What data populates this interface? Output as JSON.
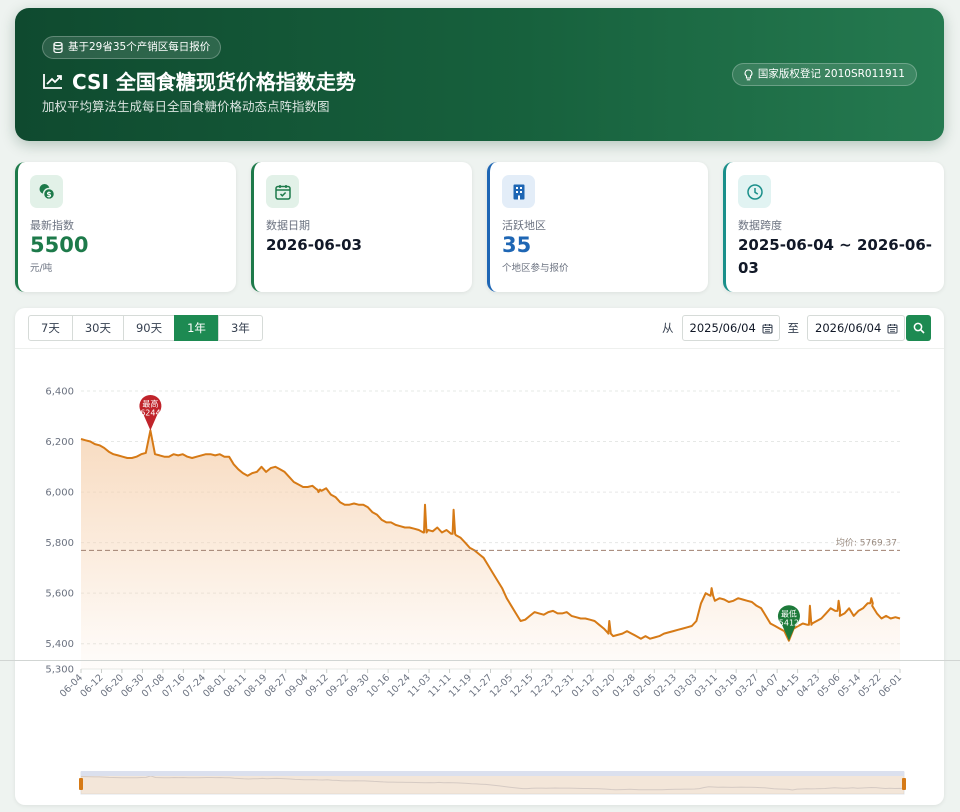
{
  "header": {
    "badge": "基于29省35个产销区每日报价",
    "title": "CSI 全国食糖现货价格指数走势",
    "subtitle": "加权平均算法生成每日全国食糖价格动态点阵指数图",
    "registration": "国家版权登记 2010SR011911"
  },
  "stats": [
    {
      "label": "最新指数",
      "value": "5500",
      "sub": "元/吨",
      "icon": "dollar-coins-icon",
      "color": "#1d7a4a"
    },
    {
      "label": "数据日期",
      "value": "2026-06-03",
      "sub": "",
      "icon": "calendar-check-icon",
      "color": "#1d7a4a"
    },
    {
      "label": "活跃地区",
      "value": "35",
      "sub": "个地区参与报价",
      "icon": "building-icon",
      "color": "#1e66b4"
    },
    {
      "label": "数据跨度",
      "value": "2025-06-04 ~ 2026-06-03",
      "sub": "",
      "icon": "clock-icon",
      "color": "#1a8f8a"
    }
  ],
  "controls": {
    "ranges": [
      "7天",
      "30天",
      "90天",
      "1年",
      "3年"
    ],
    "active_range": "1年",
    "from_label": "从",
    "from_date": "2025/06/04",
    "to_label": "至",
    "to_date": "2026/06/04"
  },
  "chart_data": {
    "type": "line",
    "title": "",
    "ylim": [
      5300,
      6400
    ],
    "yticks": [
      5300,
      5400,
      5600,
      5800,
      6000,
      6200,
      6400
    ],
    "ytick_labels": [
      "5,300",
      "5,400",
      "5,600",
      "5,800",
      "6,000",
      "6,200",
      "6,400"
    ],
    "xtick_labels": [
      "06-04",
      "06-12",
      "06-20",
      "06-30",
      "07-08",
      "07-16",
      "07-24",
      "08-01",
      "08-11",
      "08-19",
      "08-27",
      "09-04",
      "09-12",
      "09-22",
      "09-30",
      "10-16",
      "10-24",
      "11-03",
      "11-11",
      "11-19",
      "11-27",
      "12-05",
      "12-15",
      "12-23",
      "12-31",
      "01-12",
      "01-20",
      "01-28",
      "02-05",
      "02-13",
      "03-03",
      "03-11",
      "03-19",
      "03-27",
      "04-07",
      "04-15",
      "04-23",
      "05-06",
      "05-14",
      "05-22",
      "06-01"
    ],
    "series": [
      {
        "values": [
          6210,
          6205,
          6200,
          6190,
          6185,
          6175,
          6160,
          6150,
          6145,
          6140,
          6135,
          6135,
          6140,
          6150,
          6155,
          6244,
          6150,
          6145,
          6140,
          6140,
          6150,
          6145,
          6150,
          6140,
          6135,
          6140,
          6145,
          6150,
          6150,
          6145,
          6150,
          6140,
          6140,
          6110,
          6090,
          6075,
          6065,
          6075,
          6080,
          6100,
          6080,
          6095,
          6100,
          6090,
          6080,
          6060,
          6040,
          6030,
          6020,
          6020,
          6025,
          6010,
          6005,
          6015,
          5990,
          5980,
          5960,
          5950,
          5950,
          5955,
          5950,
          5950,
          5940,
          5920,
          5910,
          5890,
          5880,
          5880,
          5870,
          5865,
          5860,
          5860,
          5855,
          5850,
          5840,
          5850,
          5845,
          5860,
          5840,
          5850,
          5835,
          5830,
          5820,
          5800,
          5780,
          5770,
          5755,
          5740,
          5710,
          5680,
          5650,
          5620,
          5580,
          5550,
          5520,
          5490,
          5495,
          5510,
          5525,
          5520,
          5515,
          5525,
          5530,
          5520,
          5520,
          5525,
          5510,
          5505,
          5500,
          5500,
          5495,
          5490,
          5475,
          5460,
          5440,
          5430,
          5435,
          5440,
          5450,
          5440,
          5430,
          5420,
          5430,
          5420,
          5425,
          5430,
          5440,
          5445,
          5450,
          5455,
          5460,
          5465,
          5470,
          5490,
          5560,
          5600,
          5590,
          5570,
          5580,
          5575,
          5565,
          5570,
          5580,
          5575,
          5570,
          5565,
          5550,
          5540,
          5510,
          5480,
          5470,
          5460,
          5450,
          5412,
          5460,
          5470,
          5480,
          5475,
          5480,
          5490,
          5500,
          5520,
          5540,
          5530,
          5510,
          5520,
          5540,
          5510,
          5530,
          5540,
          5560,
          5550,
          5520,
          5500,
          5510,
          5500,
          5505,
          5500
        ]
      }
    ],
    "spikes": [
      {
        "x": 0.29,
        "y": 6000
      },
      {
        "x": 0.42,
        "y": 5950
      },
      {
        "x": 0.455,
        "y": 5930
      },
      {
        "x": 0.645,
        "y": 5490
      },
      {
        "x": 0.77,
        "y": 5620
      },
      {
        "x": 0.89,
        "y": 5550
      },
      {
        "x": 0.925,
        "y": 5570
      },
      {
        "x": 0.965,
        "y": 5580
      }
    ],
    "markers": [
      {
        "label": "最高",
        "value": "6244",
        "color": "#c0242b",
        "y": 6244
      },
      {
        "label": "最低",
        "value": "5412",
        "color": "#1d7a3a",
        "y": 5412
      }
    ],
    "average": {
      "label": "均价: 5769.37",
      "value": 5769.37
    },
    "colors": {
      "line": "#d67a16",
      "fill_top": "#f6d2b0",
      "avg": "#a08070"
    }
  }
}
